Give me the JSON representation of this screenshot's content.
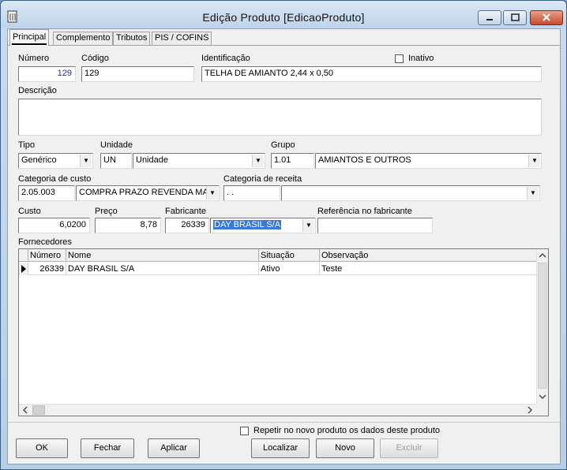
{
  "window": {
    "title": "Edição Produto [EdicaoProduto]"
  },
  "tabs": [
    {
      "label": "Principal",
      "active": true
    },
    {
      "label": "Complemento",
      "active": false
    },
    {
      "label": "Tributos",
      "active": false
    },
    {
      "label": "PIS / COFINS",
      "active": false
    }
  ],
  "fields": {
    "numero": {
      "label": "Número",
      "value": "129"
    },
    "codigo": {
      "label": "Código",
      "value": "129"
    },
    "identificacao": {
      "label": "Identificação",
      "value": "TELHA DE AMIANTO 2,44 x 0,50"
    },
    "inativo": {
      "label": "Inativo",
      "checked": false
    },
    "descricao": {
      "label": "Descrição",
      "value": ""
    },
    "tipo": {
      "label": "Tipo",
      "value": "Genérico"
    },
    "unidade": {
      "label": "Unidade",
      "code": "UN",
      "value": "Unidade"
    },
    "grupo": {
      "label": "Grupo",
      "code": "1.01",
      "value": "AMIANTOS E OUTROS"
    },
    "categoria_custo": {
      "label": "Categoria de custo",
      "code": "2.05.003",
      "value": "COMPRA PRAZO REVENDA MAT"
    },
    "categoria_receita": {
      "label": "Categoria de receita",
      "code": ". .",
      "value": ""
    },
    "custo": {
      "label": "Custo",
      "value": "6,0200"
    },
    "preco": {
      "label": "Preço",
      "value": "8,78"
    },
    "fabricante": {
      "label": "Fabricante",
      "code": "26339",
      "value": "DAY BRASIL S/A"
    },
    "referencia": {
      "label": "Referência no fabricante",
      "value": ""
    }
  },
  "fornecedores": {
    "label": "Fornecedores",
    "columns": [
      "Número",
      "Nome",
      "Situação",
      "Observação"
    ],
    "rows": [
      {
        "numero": "26339",
        "nome": "DAY BRASIL S/A",
        "situacao": "Ativo",
        "observacao": "Teste"
      }
    ]
  },
  "repetir": {
    "label": "Repetir no novo produto os dados deste produto",
    "checked": false
  },
  "buttons": {
    "ok": "OK",
    "fechar": "Fechar",
    "aplicar": "Aplicar",
    "localizar": "Localizar",
    "novo": "Novo",
    "excluir": "Excluir"
  },
  "icons": {
    "app": "document-icon",
    "minimize": "minimize-icon",
    "maximize": "maximize-icon",
    "close": "close-icon",
    "dropdown": "chevron-down-icon",
    "row_indicator": "triangle-right-icon"
  }
}
